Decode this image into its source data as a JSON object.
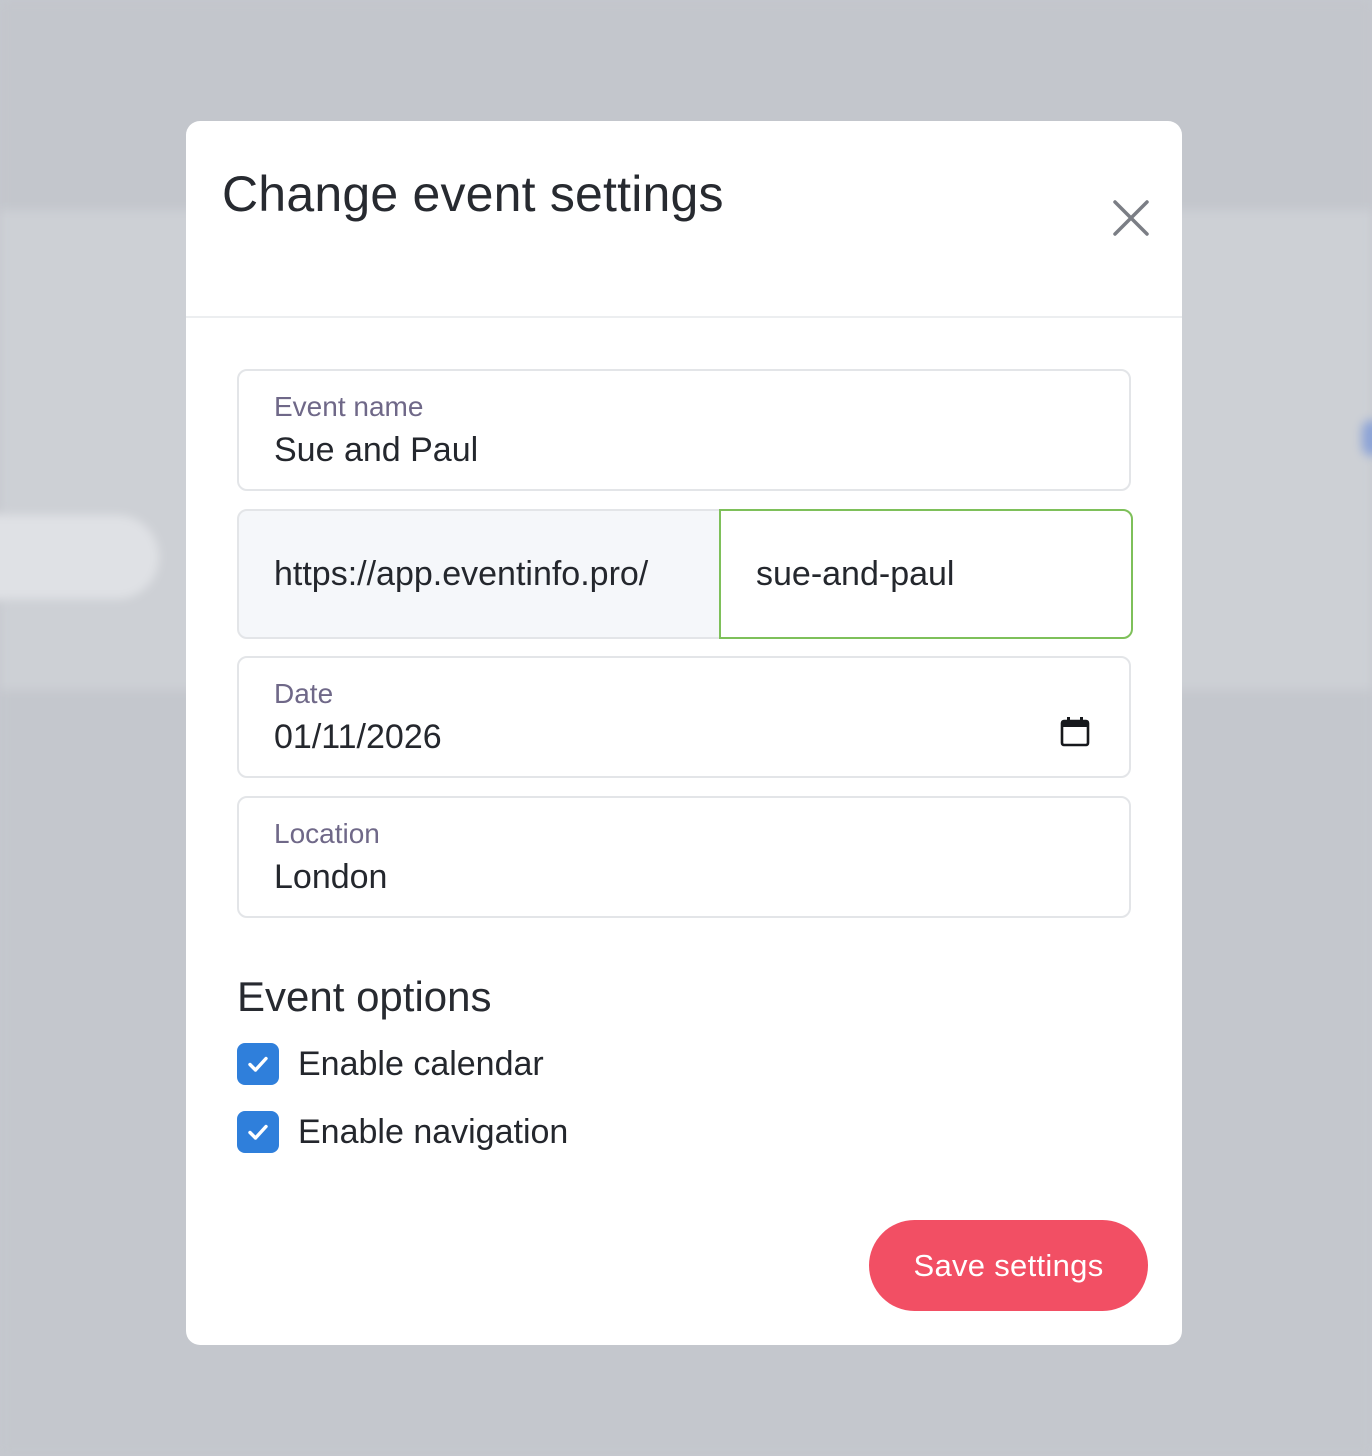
{
  "modal": {
    "title": "Change event settings"
  },
  "fields": {
    "event_name": {
      "label": "Event name",
      "value": "Sue and Paul"
    },
    "url": {
      "prefix": "https://app.eventinfo.pro/",
      "slug": "sue-and-paul"
    },
    "date": {
      "label": "Date",
      "value": "01/11/2026"
    },
    "location": {
      "label": "Location",
      "value": "London"
    }
  },
  "options": {
    "title": "Event options",
    "items": [
      {
        "label": "Enable calendar",
        "checked": true
      },
      {
        "label": "Enable navigation",
        "checked": true
      }
    ]
  },
  "actions": {
    "save_label": "Save settings"
  },
  "colors": {
    "accent": "#f24f64",
    "checkbox": "#2f7fdb",
    "focus_border": "#7ec05a",
    "label": "#6f6888"
  },
  "icons": {
    "close": "close-icon",
    "calendar": "calendar-icon",
    "check": "checkmark-icon"
  }
}
